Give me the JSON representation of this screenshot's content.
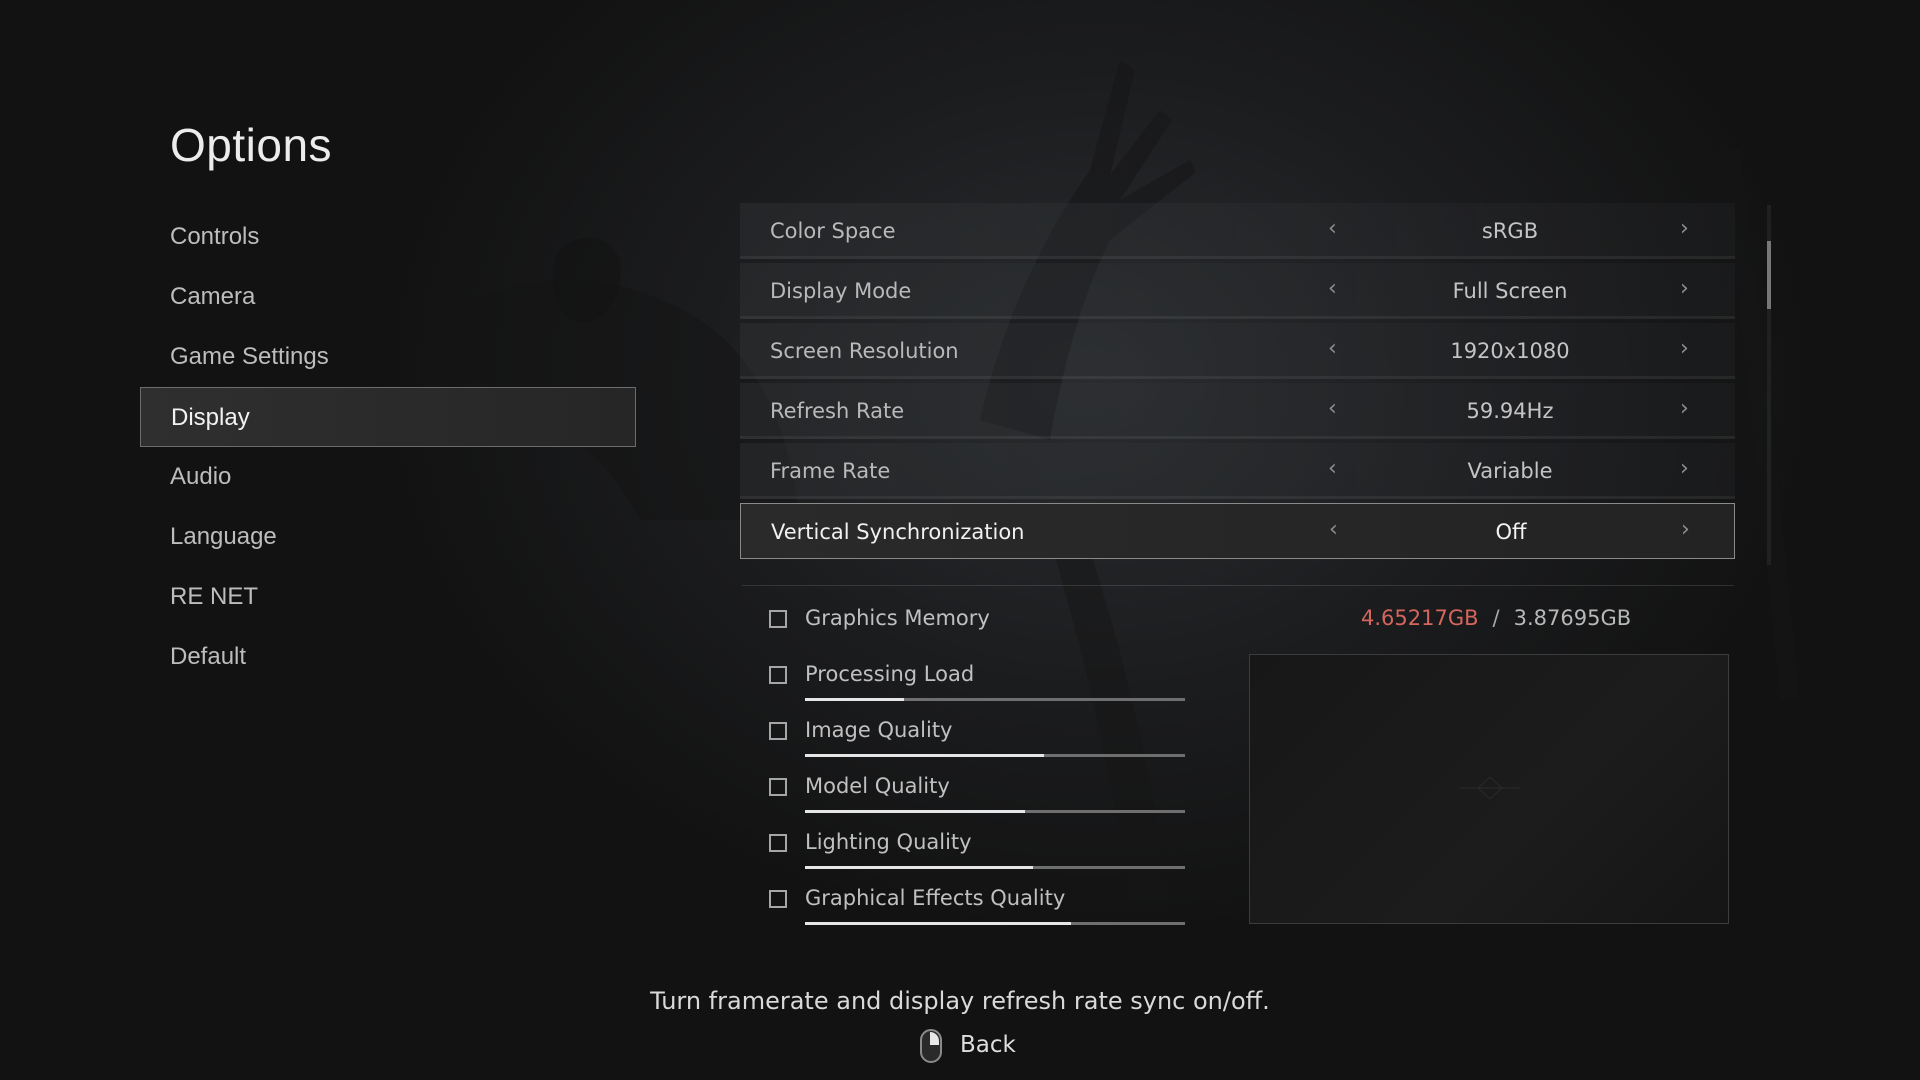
{
  "title": "Options",
  "nav": {
    "items": [
      {
        "label": "Controls"
      },
      {
        "label": "Camera"
      },
      {
        "label": "Game Settings"
      },
      {
        "label": "Display",
        "active": true
      },
      {
        "label": "Audio"
      },
      {
        "label": "Language"
      },
      {
        "label": "RE NET"
      },
      {
        "label": "Default"
      }
    ]
  },
  "settings": [
    {
      "label": "Color Space",
      "value": "sRGB"
    },
    {
      "label": "Display Mode",
      "value": "Full Screen"
    },
    {
      "label": "Screen Resolution",
      "value": "1920x1080"
    },
    {
      "label": "Refresh Rate",
      "value": "59.94Hz"
    },
    {
      "label": "Frame Rate",
      "value": "Variable"
    },
    {
      "label": "Vertical Synchronization",
      "value": "Off",
      "active": true
    }
  ],
  "arrows": {
    "left": "‹",
    "right": "›"
  },
  "graphics": {
    "memory_label": "Graphics Memory",
    "memory_used": "4.65217GB",
    "memory_separator": "/",
    "memory_total": "3.87695GB",
    "items": [
      {
        "label": "Processing Load",
        "level": 0.26
      },
      {
        "label": "Image Quality",
        "level": 0.63
      },
      {
        "label": "Model Quality",
        "level": 0.58
      },
      {
        "label": "Lighting Quality",
        "level": 0.6
      },
      {
        "label": "Graphical Effects Quality",
        "level": 0.7
      }
    ]
  },
  "description": "Turn framerate and display refresh rate sync on/off.",
  "footer": {
    "back_label": "Back",
    "back_icon": "mouse-right-click-icon"
  },
  "colors": {
    "memory_over": "#d4665e",
    "accent_bar": "#e6e6e6"
  }
}
